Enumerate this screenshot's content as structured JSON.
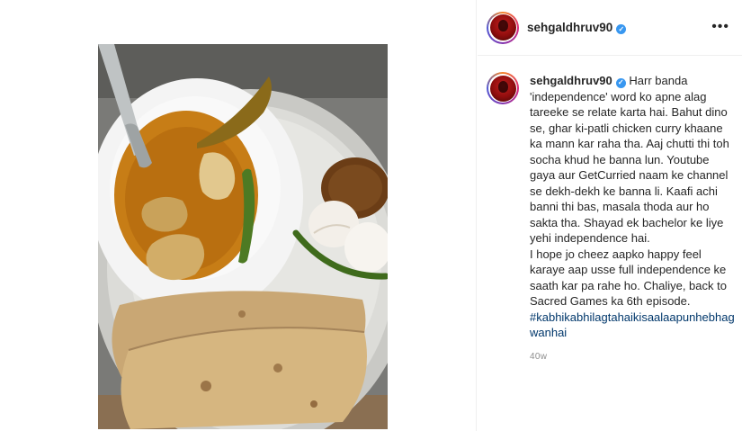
{
  "post": {
    "username": "sehgaldhruv90",
    "more_label": "•••",
    "caption_lines": [
      "Harr banda",
      "'independence' word ko apne alag",
      "tareeke se relate karta hai. Bahut dino",
      "se, ghar ki-patli chicken curry khaane",
      "ka mann kar raha tha. Aaj chutti thi toh",
      "socha khud he banna lun. Youtube",
      "gaya aur GetCurried naam ke channel",
      "se dekh-dekh ke banna li. Kaafi achi",
      "banni thi bas, masala thoda aur ho",
      "sakta tha. Shayad ek bachelor ke liye",
      "yehi independence hai.",
      "I hope jo cheez aapko happy feel",
      "karaye aap usse full independence ke",
      "saath kar pa rahe ho. Chaliye, back to",
      "Sacred Games ka 6th episode."
    ],
    "hashtag_lines": [
      "#kabhikabhilagtahaikisaalaapunhebhag",
      "wanhai"
    ],
    "timestamp": "40w",
    "photo_alt": "Plate with chicken curry, rotis, onion and chilli",
    "colors": {
      "verified": "#3897f0",
      "hashtag": "#00376b",
      "meta": "#8e8e8e"
    }
  }
}
